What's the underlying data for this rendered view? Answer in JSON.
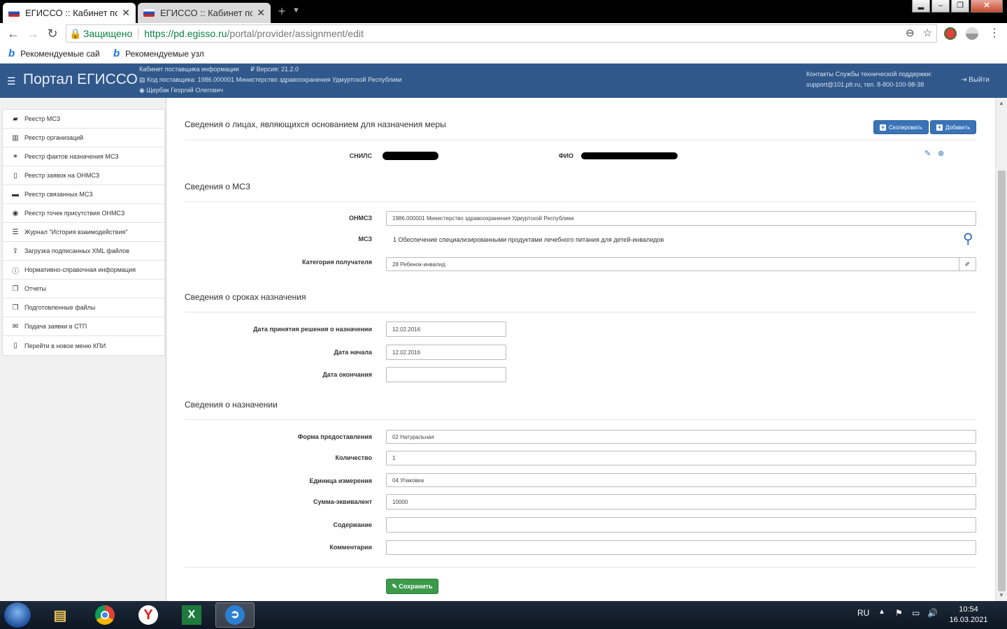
{
  "browser": {
    "tabs": [
      {
        "title": "ЕГИССО :: Кабинет поста",
        "active": true
      },
      {
        "title": "ЕГИССО :: Кабинет поста",
        "active": false
      }
    ],
    "secure_label": "Защищено",
    "url_host": "https://pd.egisso.ru",
    "url_path": "/portal/provider/assignment/edit",
    "bookmarks": [
      "Рекомендуемые сай",
      "Рекомендуемые узл"
    ]
  },
  "header": {
    "title": "Портал ЕГИССО",
    "cabinet": "Кабинет поставщика информации",
    "version": "Версия: 21.2.0",
    "provider_code": "Код поставщика: 1986.000001 Министерство здравоохранения Удмуртской Республики",
    "user": "Щербак Георгий Олегович",
    "support_title": "Контакты Службы технической поддержки:",
    "support_contact": "support@101.pfr.ru, тел. 8-800-100-98-38",
    "logout": "Выйти"
  },
  "sidebar": {
    "items": [
      {
        "label": "Реестр МСЗ",
        "icon": "book-icon"
      },
      {
        "label": "Реестр организаций",
        "icon": "bank-icon"
      },
      {
        "label": "Реестр фактов назначения МСЗ",
        "icon": "handshake-icon"
      },
      {
        "label": "Реестр заявок на ОНМСЗ",
        "icon": "document-icon"
      },
      {
        "label": "Реестр связанных МСЗ",
        "icon": "card-icon"
      },
      {
        "label": "Реестр точек присутствия ОНМСЗ",
        "icon": "target-icon"
      },
      {
        "label": "Журнал \"История взаимодействия\"",
        "icon": "list-icon"
      },
      {
        "label": "Загрузка подписанных XML файлов",
        "icon": "upload-icon"
      },
      {
        "label": "Нормативно-справочная информация",
        "icon": "info-icon"
      },
      {
        "label": "Отчеты",
        "icon": "copy-icon"
      },
      {
        "label": "Подготовленные файлы",
        "icon": "copy-icon"
      },
      {
        "label": "Подача заявки в СТП",
        "icon": "envelope-icon"
      },
      {
        "label": "Перейти в новое меню КПИ",
        "icon": "document-icon"
      }
    ]
  },
  "main": {
    "persons_section": "Сведения о лицах, являющихся основанием для назначения меры",
    "copy_button": "Скопировать",
    "add_button": "Добавить",
    "snils_label": "СНИЛС",
    "fio_label": "ФИО",
    "msz_section": "Сведения о МСЗ",
    "onmsz_label": "ОНМСЗ",
    "onmsz_value": "1986.000001 Министерство здравоохранения Удмуртской Республики",
    "msz_label": "МСЗ",
    "msz_value": "1 Обеспечение специализированными продуктами лечебного питания для детей-инвалидов",
    "category_label": "Категория получателя",
    "category_value": "28 Ребенок-инвалид",
    "terms_section": "Сведения о сроках назначения",
    "decision_date_label": "Дата принятия решения о назначении",
    "decision_date_value": "12.02.2016",
    "start_date_label": "Дата начала",
    "start_date_value": "12.02.2016",
    "end_date_label": "Дата окончания",
    "end_date_value": "",
    "assign_section": "Сведения о назначении",
    "form_label": "Форма предоставления",
    "form_value": "02 Натуральная",
    "qty_label": "Количество",
    "qty_value": "1",
    "unit_label": "Единица измерения",
    "unit_value": "04 Упаковка",
    "sum_label": "Сумма-эквивалент",
    "sum_value": "10000",
    "content_label": "Содержание",
    "content_value": "",
    "comment_label": "Комментарии",
    "comment_value": "",
    "save_button": "Сохранить"
  },
  "taskbar": {
    "lang": "RU",
    "time": "10:54",
    "date": "16.03.2021"
  }
}
